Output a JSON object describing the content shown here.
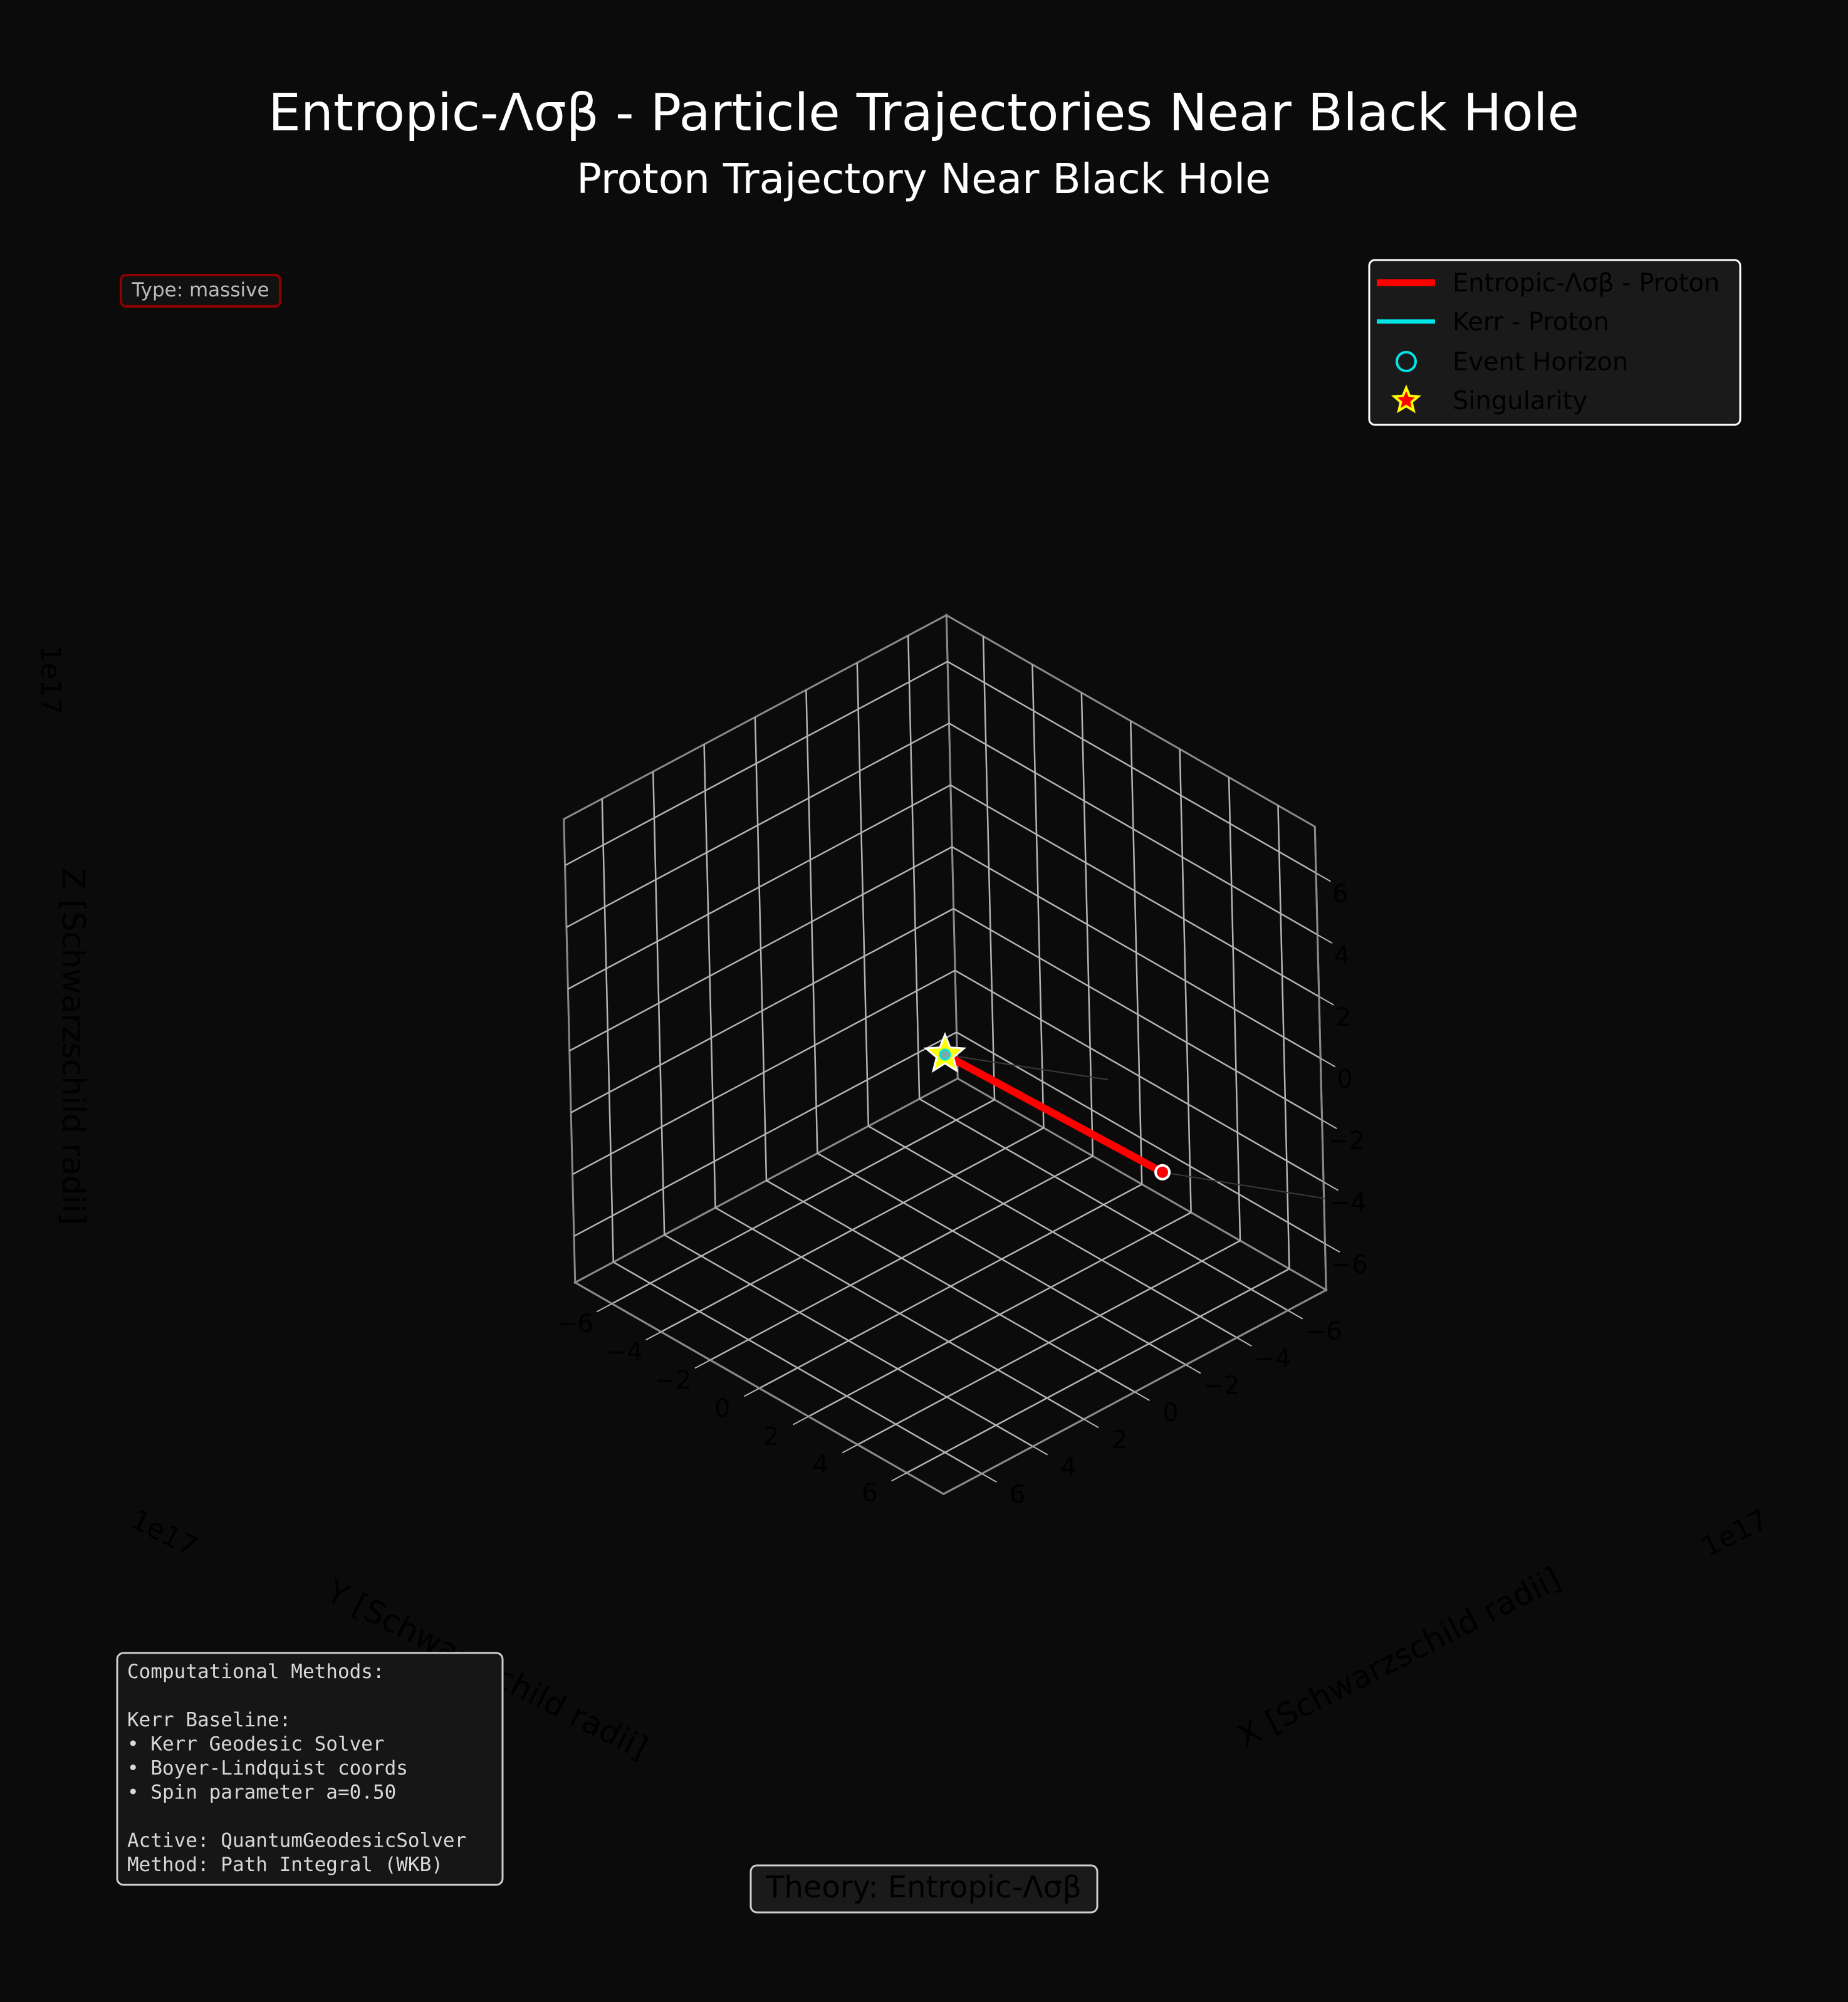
{
  "figure": {
    "suptitle": "Entropic-Λσβ - Particle Trajectories Near Black Hole",
    "title": "Proton Trajectory Near Black Hole",
    "type_badge": "Type: massive",
    "theory_badge": "Theory: Entropic-Λσβ",
    "methods_box": [
      "Computational Methods:",
      "",
      "Kerr Baseline:",
      "• Kerr Geodesic Solver",
      "• Boyer-Lindquist coords",
      "• Spin parameter a=0.50",
      "",
      "Active: QuantumGeodesicSolver",
      "Method: Path Integral (WKB)"
    ]
  },
  "legend": {
    "items": [
      {
        "label": "Entropic-Λσβ - Proton",
        "marker": "line",
        "color": "#ff0000"
      },
      {
        "label": "Kerr - Proton",
        "marker": "line",
        "color": "#00e5e5"
      },
      {
        "label": "Event Horizon",
        "marker": "circle",
        "color": "#00e5e5"
      },
      {
        "label": "Singularity",
        "marker": "star",
        "color": "#ffff00"
      }
    ]
  },
  "chart_data": {
    "type": "line3d",
    "xlabel": "X [Schwarzschild radii]",
    "ylabel": "Y [Schwarzschild radii]",
    "zlabel": "Z [Schwarzschild radii]",
    "offset_text": {
      "x": "1e17",
      "y": "1e17",
      "z": "1e17"
    },
    "xlim": [
      -7.5,
      7.5
    ],
    "ylim": [
      -7.5,
      7.5
    ],
    "zlim": [
      -7.5,
      7.5
    ],
    "ticks": [
      -6,
      -4,
      -2,
      0,
      2,
      4,
      6
    ],
    "tick_labels": [
      "−6",
      "−4",
      "−2",
      "0",
      "2",
      "4",
      "6"
    ],
    "grid": true,
    "legend_position": "top-right",
    "series": [
      {
        "name": "Entropic-Λσβ - Proton",
        "color": "#ff0000",
        "points": [
          [
            0,
            0,
            0
          ],
          [
            7.9,
            -0.9,
            -0.6
          ]
        ],
        "start_marker": [
          7.9,
          -0.9,
          -0.6
        ]
      }
    ],
    "event_horizon": [
      0,
      0,
      0
    ],
    "singularity": [
      0,
      0,
      0
    ]
  },
  "colors": {
    "background": "#0b0b0b",
    "text": "#ffffff",
    "grid": "#b4b4b4",
    "axis_label": "#000000",
    "trajectory": "#ff0000",
    "horizon": "#00e5e5",
    "singularity": "#ffff00"
  }
}
